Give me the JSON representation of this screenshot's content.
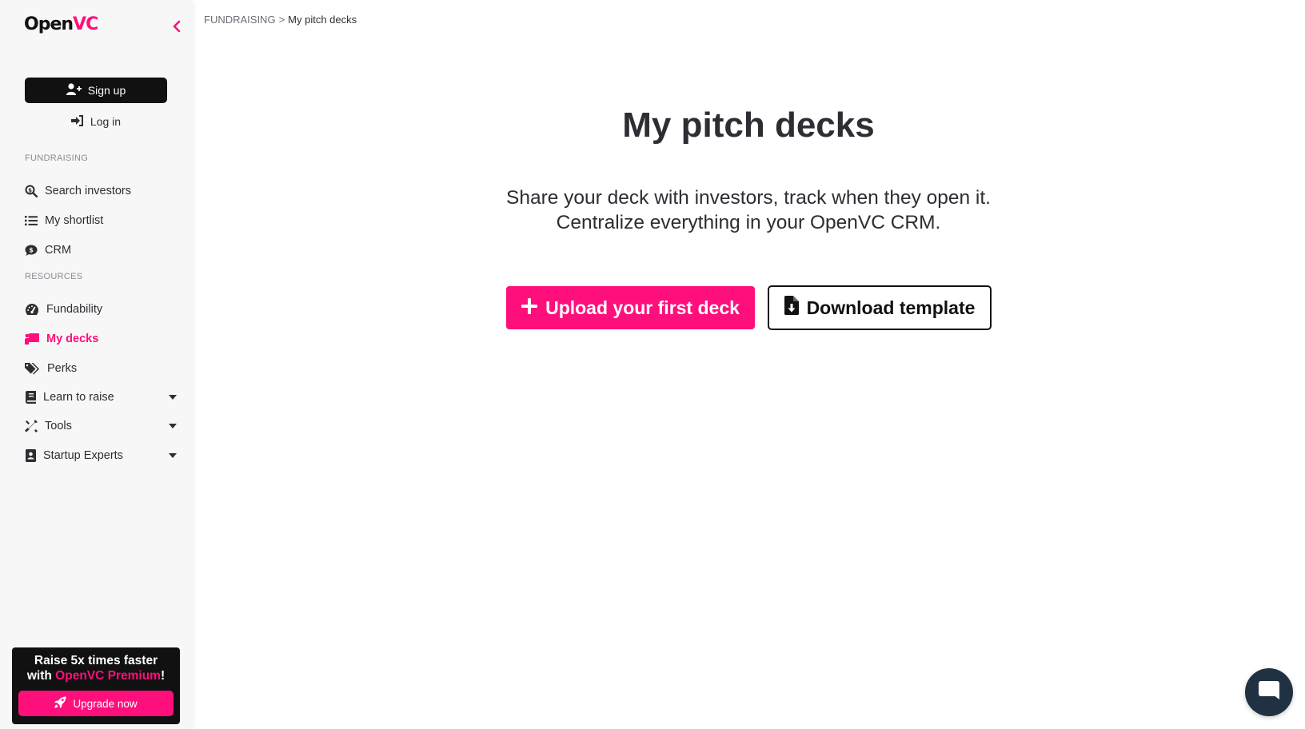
{
  "brand": {
    "name_part1": "Open",
    "name_part2": "VC",
    "accent": "#ff0f7b"
  },
  "auth": {
    "signup_label": "Sign up",
    "login_label": "Log in"
  },
  "sidebar": {
    "sections": [
      {
        "label": "FUNDRAISING"
      },
      {
        "label": "RESOURCES"
      }
    ],
    "items": [
      {
        "label": "Search investors",
        "icon": "search-dollar-icon"
      },
      {
        "label": "My shortlist",
        "icon": "list-icon"
      },
      {
        "label": "CRM",
        "icon": "comment-dollar-icon"
      },
      {
        "label": "Fundability",
        "icon": "gauge-icon"
      },
      {
        "label": "My decks",
        "icon": "chalkboard-icon",
        "active": true
      },
      {
        "label": "Perks",
        "icon": "tags-icon"
      },
      {
        "label": "Learn to raise",
        "icon": "book-icon",
        "expandable": true
      },
      {
        "label": "Tools",
        "icon": "tools-icon",
        "expandable": true
      },
      {
        "label": "Startup Experts",
        "icon": "address-book-icon",
        "expandable": true
      }
    ]
  },
  "promo": {
    "line1": "Raise 5x times faster",
    "line2_prefix": "with ",
    "line2_highlight": "OpenVC Premium",
    "line2_suffix": "!",
    "button_label": "Upgrade now"
  },
  "breadcrumb": {
    "parent": "FUNDRAISING",
    "separator": ">",
    "current": "My pitch decks"
  },
  "main": {
    "title": "My pitch decks",
    "subtitle_line1": "Share your deck with investors, track when they open it.",
    "subtitle_line2": "Centralize everything in your OpenVC CRM.",
    "upload_label": "Upload your first deck",
    "template_label": "Download template"
  }
}
